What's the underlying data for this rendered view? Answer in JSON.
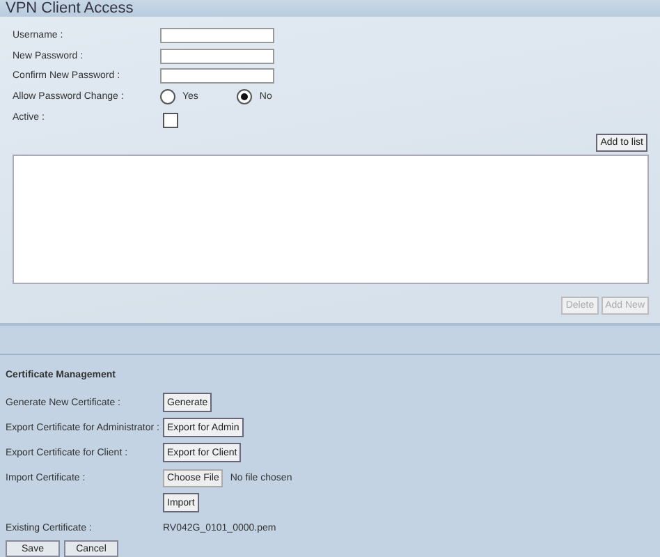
{
  "window": {
    "title": "VPN Client Access"
  },
  "fields": [
    {
      "label": "Username :"
    },
    {
      "label": "New Password :"
    },
    {
      "label": "Confirm New Password :"
    }
  ],
  "allow_password_change": {
    "label": "Allow Password Change :",
    "options": [
      {
        "label": "Yes",
        "selected": false
      },
      {
        "label": "No",
        "selected": true
      }
    ]
  },
  "active": {
    "label": "Active :",
    "checked": false
  },
  "add_button": "Add to list",
  "list_buttons": [
    {
      "label": "Delete",
      "disabled": true
    },
    {
      "label": "Add New",
      "disabled": true
    }
  ],
  "certificate": {
    "title": "Certificate Management",
    "rows": [
      {
        "kind": "button",
        "label": "Generate New Certificate :",
        "button": "Generate"
      },
      {
        "kind": "button",
        "label": "Export Certificate for Administrator :",
        "button": "Export for Admin"
      },
      {
        "kind": "button",
        "label": "Export Certificate for Client :",
        "button": "Export for Client"
      },
      {
        "kind": "file",
        "label": "Import Certificate :",
        "button": "Choose File",
        "status": "No file chosen"
      },
      {
        "kind": "button",
        "button": "Import"
      },
      {
        "kind": "text",
        "label": "Existing Certificate :",
        "value": "RV042G_0101_0000.pem"
      }
    ]
  },
  "buttons": [
    "Save",
    "Cancel"
  ]
}
